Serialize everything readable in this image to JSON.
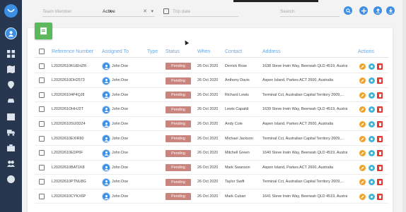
{
  "filters": {
    "team_member_placeholder": "Team Member",
    "status_value": "Active",
    "trip_date_placeholder": "Trip date",
    "search_placeholder": "Search"
  },
  "table": {
    "headers": {
      "reference": "Reference Number",
      "assigned": "Assigned To",
      "type": "Type",
      "status": "Status",
      "when": "When",
      "contact": "Contact",
      "address": "Address",
      "actions": "Actions"
    },
    "rows": [
      {
        "ref": "L20202610KUEHZR",
        "assigned": "John Doe",
        "status": "Pending",
        "when": "26 Oct 2020",
        "contact": "Derrick Rose",
        "address": "1638 Steve Irwin Way, Beerwah QLD 4519, Austra..."
      },
      {
        "ref": "L20202610DH2573",
        "assigned": "John Doe",
        "status": "Pending",
        "when": "26 Oct 2020",
        "contact": "Anthony Davis",
        "address": "Aspen Island, Parkes ACT 2600, Australia"
      },
      {
        "ref": "L202026104P4QJ8",
        "assigned": "John Doe",
        "status": "Pending",
        "when": "26 Oct 2020",
        "contact": "Richard Lewis",
        "address": "Terminal Cct, Australian Capital Territory 2609,..."
      },
      {
        "ref": "L2020261OHHJ2T",
        "assigned": "John Doe",
        "status": "Pending",
        "when": "26 Oct 2020",
        "contact": "Lewis Capaldi",
        "address": "1639 Steve Irwin Way, Beerwah QLD 4519, Austra..."
      },
      {
        "ref": "L20202610SU0DZ4",
        "assigned": "John Doe",
        "status": "Pending",
        "when": "26 Oct 2020",
        "contact": "Andy Cole",
        "address": "Aspen Island, Parkes ACT 2600, Australia"
      },
      {
        "ref": "L20202610EXIR60",
        "assigned": "John Doe",
        "status": "Pending",
        "when": "26 Oct 2020",
        "contact": "Michael Jackson",
        "address": "Terminal Cct, Australian Capital Territory 2609,..."
      },
      {
        "ref": "L20202610EDP6F",
        "assigned": "John Doe",
        "status": "Pending",
        "when": "26 Oct 2020",
        "contact": "Mitchell Green",
        "address": "1640 Steve Irwin Way, Beerwah QLD 4519, Austra..."
      },
      {
        "ref": "L20202610BAT1K8",
        "assigned": "John Doe",
        "status": "Pending",
        "when": "26 Oct 2020",
        "contact": "Mark Swanson",
        "address": "Aspen Island, Parkes ACT 2600, Australia"
      },
      {
        "ref": "L20202610PTNU8G",
        "assigned": "John Doe",
        "status": "Pending",
        "when": "26 Oct 2020",
        "contact": "Taylor Swift",
        "address": "Terminal Cct, Australian Capital Territory 2609,..."
      },
      {
        "ref": "L20202610CYKX6P",
        "assigned": "John Doe",
        "status": "Pending",
        "when": "26 Oct 2020",
        "contact": "Mark Cuban",
        "address": "1641 Steve Irwin Way, Beerwah QLD 4519, Austra..."
      }
    ]
  },
  "colors": {
    "sidebar": "#27374f",
    "primary": "#3d8fe6",
    "status_pending": "#c9847e",
    "edit": "#f0a32a",
    "view": "#3fb6d7",
    "delete": "#e0392f",
    "add": "#5cb85c"
  }
}
